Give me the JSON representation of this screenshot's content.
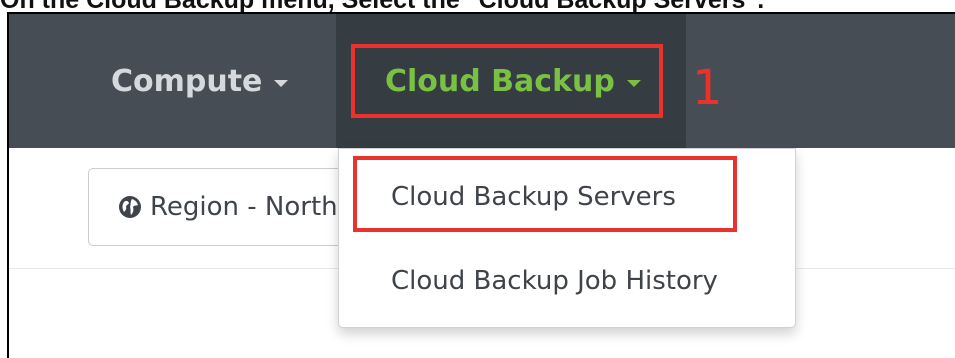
{
  "caption": "On the Cloud Backup menu, Select the \"Cloud Backup Servers\".",
  "navbar": {
    "items": [
      {
        "label": "Compute"
      },
      {
        "label": "Cloud Backup"
      }
    ],
    "active_color": "#7ac143",
    "background": "#464d55"
  },
  "annotations": {
    "step_number": "1",
    "highlight_color": "#e8322b"
  },
  "toolbar": {
    "region_label": "Region - North",
    "region_icon": "globe-icon"
  },
  "dropdown": {
    "items": [
      {
        "label": "Cloud Backup Servers"
      },
      {
        "label": "Cloud Backup Job History"
      }
    ]
  }
}
